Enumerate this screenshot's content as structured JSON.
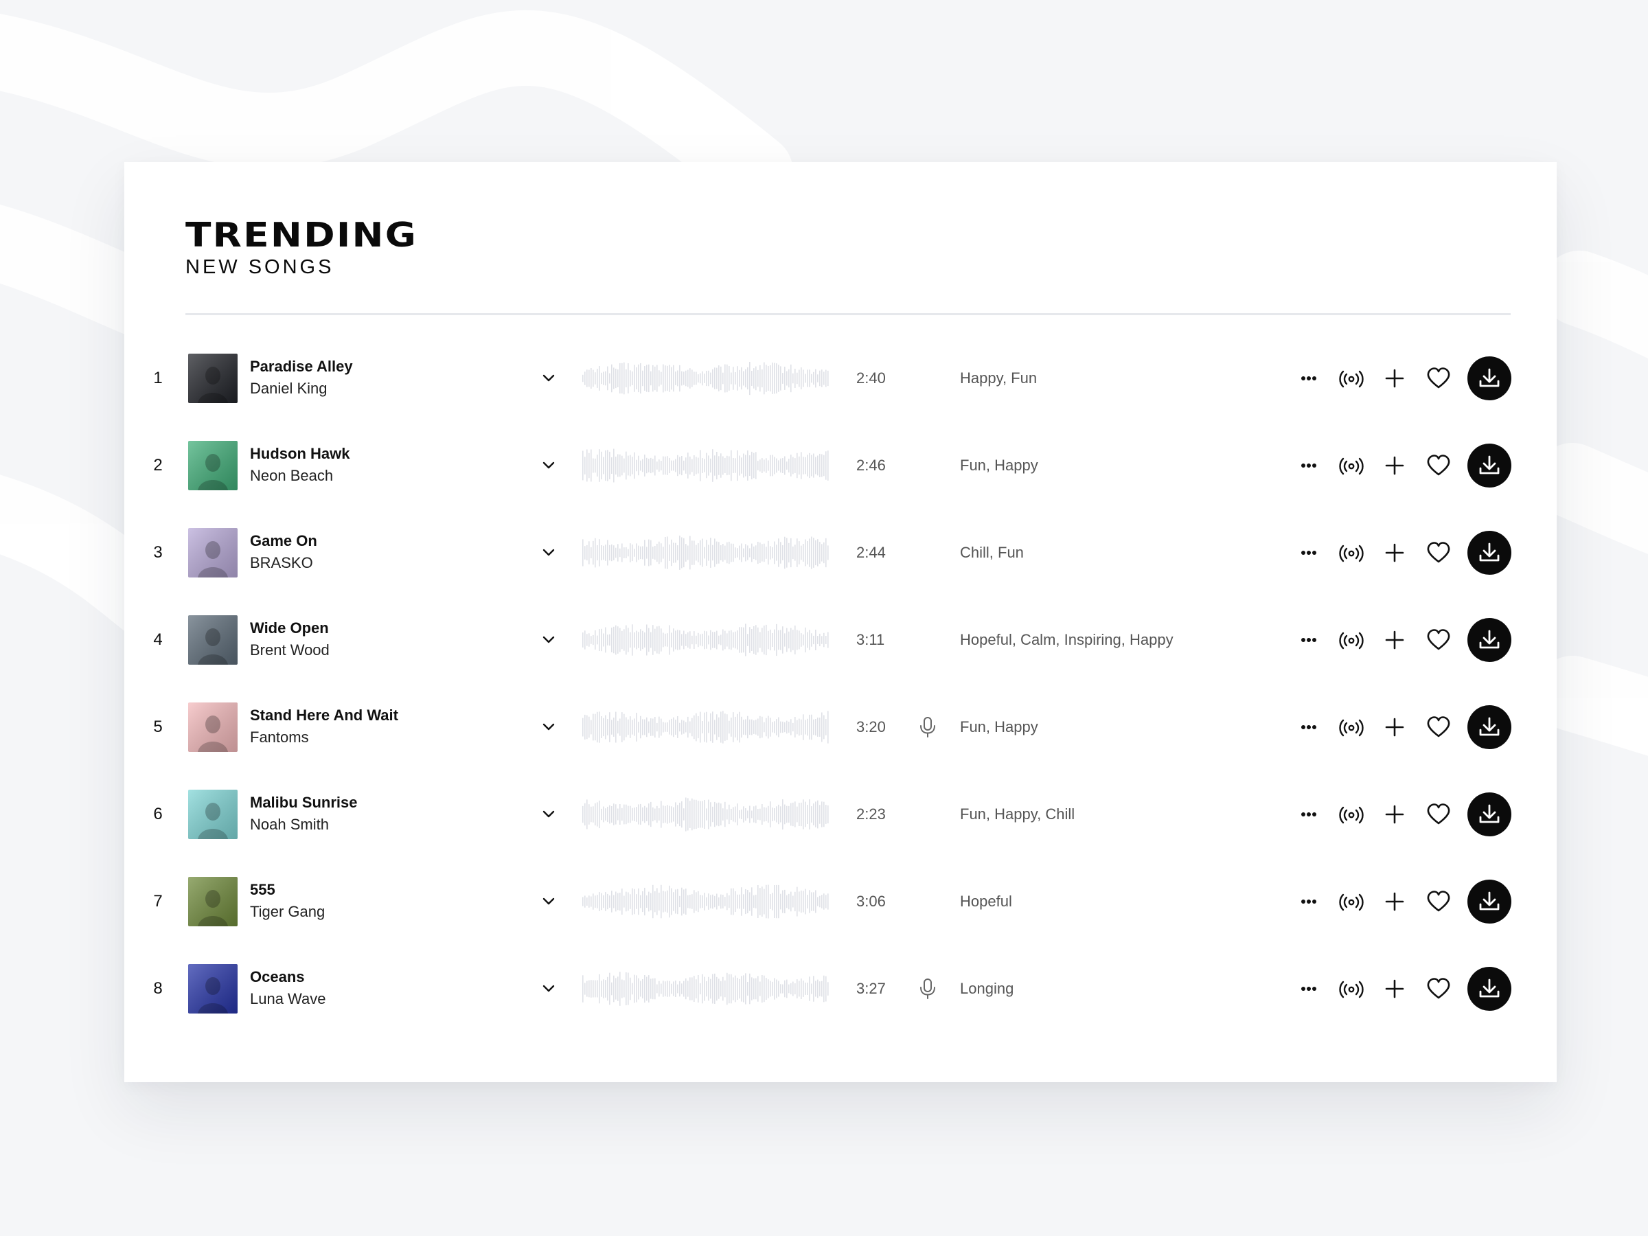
{
  "header": {
    "title": "TRENDING",
    "subtitle": "NEW SONGS"
  },
  "colors": {
    "background": "#f5f6f8",
    "card": "#ffffff",
    "text": "#111111",
    "muted_text": "#555555",
    "waveform": "#dfe1e7",
    "download_button": "#0b0b0b"
  },
  "icons": {
    "expand": "chevron-down-icon",
    "vocals": "microphone-icon",
    "more": "more-dots-icon",
    "similar": "broadcast-icon",
    "add": "plus-icon",
    "like": "heart-icon",
    "download": "download-icon"
  },
  "tracks": [
    {
      "num": "1",
      "title": "Paradise Alley",
      "artist": "Daniel King",
      "duration": "2:40",
      "tags": "Happy, Fun",
      "vocals": false,
      "cover": "#202228"
    },
    {
      "num": "2",
      "title": "Hudson Hawk",
      "artist": "Neon Beach",
      "duration": "2:46",
      "tags": "Fun, Happy",
      "vocals": false,
      "cover": "#3fae78"
    },
    {
      "num": "3",
      "title": "Game On",
      "artist": "BRASKO",
      "duration": "2:44",
      "tags": "Chill, Fun",
      "vocals": false,
      "cover": "#b8a9d8"
    },
    {
      "num": "4",
      "title": "Wide Open",
      "artist": "Brent Wood",
      "duration": "3:11",
      "tags": "Hopeful, Calm, Inspiring, Happy",
      "vocals": false,
      "cover": "#5c6b78"
    },
    {
      "num": "5",
      "title": "Stand Here And Wait",
      "artist": "Fantoms",
      "duration": "3:20",
      "tags": "Fun, Happy",
      "vocals": true,
      "cover": "#f4b9bb"
    },
    {
      "num": "6",
      "title": "Malibu Sunrise",
      "artist": "Noah Smith",
      "duration": "2:23",
      "tags": "Fun, Happy, Chill",
      "vocals": false,
      "cover": "#7fd6d6"
    },
    {
      "num": "7",
      "title": "555",
      "artist": "Tiger Gang",
      "duration": "3:06",
      "tags": "Hopeful",
      "vocals": false,
      "cover": "#6f8a3a"
    },
    {
      "num": "8",
      "title": "Oceans",
      "artist": "Luna Wave",
      "duration": "3:27",
      "tags": "Longing",
      "vocals": true,
      "cover": "#2634a8"
    }
  ]
}
